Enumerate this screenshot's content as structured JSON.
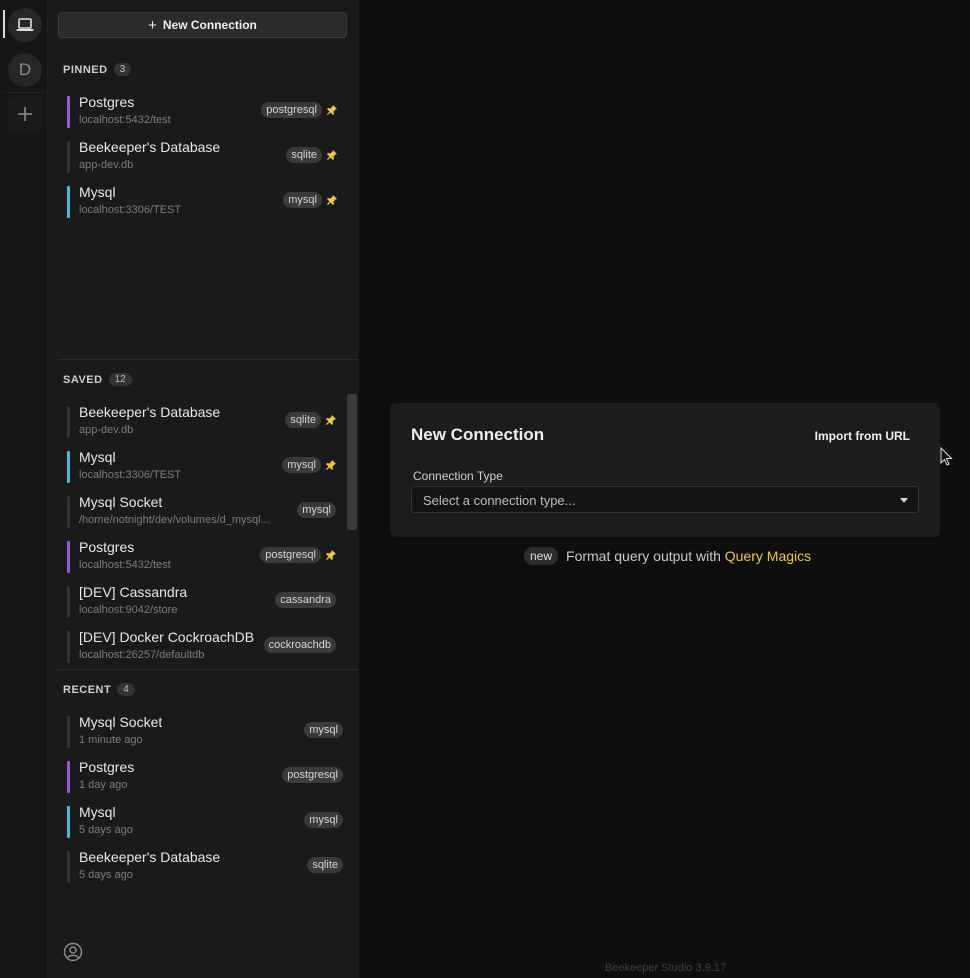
{
  "activity": {
    "icons": [
      "laptop-icon",
      "workspace-avatar",
      "plus-icon",
      "user-circle-icon"
    ],
    "workspace_letter": "D"
  },
  "sidebar": {
    "new_connection_label": "New Connection",
    "pinned": {
      "title": "PINNED",
      "count": "3",
      "items": [
        {
          "name": "Postgres",
          "sub": "localhost:5432/test",
          "type": "postgresql",
          "color": "#9b59d6",
          "pinned": true
        },
        {
          "name": "Beekeeper's Database",
          "sub": "app-dev.db",
          "type": "sqlite",
          "color": "#333333",
          "pinned": true
        },
        {
          "name": "Mysql",
          "sub": "localhost:3306/TEST",
          "type": "mysql",
          "color": "#4ab8d8",
          "pinned": true
        }
      ]
    },
    "saved": {
      "title": "SAVED",
      "count": "12",
      "items": [
        {
          "name": "Beekeeper's Database",
          "sub": "app-dev.db",
          "type": "sqlite",
          "color": "#333333",
          "pinned": true
        },
        {
          "name": "Mysql",
          "sub": "localhost:3306/TEST",
          "type": "mysql",
          "color": "#4ab8d8",
          "pinned": true
        },
        {
          "name": "Mysql Socket",
          "sub": "/home/notnight/dev/volumes/d_mysql...",
          "type": "mysql",
          "color": "#333333",
          "pinned": false
        },
        {
          "name": "Postgres",
          "sub": "localhost:5432/test",
          "type": "postgresql",
          "color": "#9b59d6",
          "pinned": true
        },
        {
          "name": "[DEV] Cassandra",
          "sub": "localhost:9042/store",
          "type": "cassandra",
          "color": "#333333",
          "pinned": false
        },
        {
          "name": "[DEV] Docker CockroachDB",
          "sub": "localhost:26257/defaultdb",
          "type": "cockroachdb",
          "color": "#333333",
          "pinned": false
        }
      ]
    },
    "recent": {
      "title": "RECENT",
      "count": "4",
      "items": [
        {
          "name": "Mysql Socket",
          "sub": "1 minute ago",
          "type": "mysql",
          "color": "#333333"
        },
        {
          "name": "Postgres",
          "sub": "1 day ago",
          "type": "postgresql",
          "color": "#9b59d6"
        },
        {
          "name": "Mysql",
          "sub": "5 days ago",
          "type": "mysql",
          "color": "#4ab8d8"
        },
        {
          "name": "Beekeeper's Database",
          "sub": "5 days ago",
          "type": "sqlite",
          "color": "#333333"
        }
      ]
    }
  },
  "main": {
    "card_title": "New Connection",
    "import_label": "Import from URL",
    "connection_type_label": "Connection Type",
    "select_placeholder": "Select a connection type...",
    "promo_badge": "new",
    "promo_text": "Format query output with",
    "promo_link": "Query Magics",
    "version": "Beekeeper Studio 3.9.17"
  },
  "colors": {
    "accent_yellow": "#f5c542",
    "postgres": "#9b59d6",
    "mysql": "#4ab8d8"
  }
}
